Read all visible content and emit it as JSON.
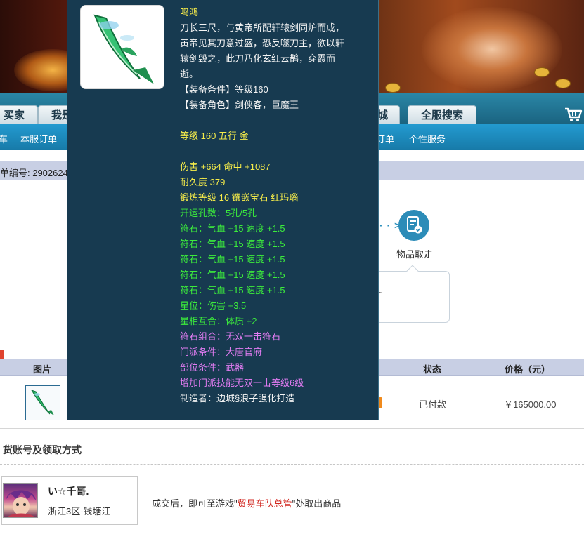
{
  "nav": {
    "tabs": [
      {
        "label": "买家"
      },
      {
        "label": "我是"
      },
      {
        "label": "城"
      },
      {
        "label": "全服搜索"
      }
    ]
  },
  "subnav": {
    "items": [
      {
        "label": "车"
      },
      {
        "label": "本服订单"
      },
      {
        "label": "订单"
      },
      {
        "label": "个性服务"
      }
    ]
  },
  "order": {
    "number_text": "单编号: 2902624"
  },
  "progress": {
    "arrow_text": "· · >",
    "step_label": "物品取走",
    "tooltip_text": "~"
  },
  "table": {
    "headers": {
      "image": "图片",
      "status": "状态",
      "price": "价格（元）"
    },
    "row": {
      "status": "已付款",
      "price": "￥165000.00"
    }
  },
  "section": {
    "title": "货账号及领取方式"
  },
  "seller": {
    "name": "い☆千哥.",
    "server": "浙江3区-钱塘江"
  },
  "pickup": {
    "before": "成交后，即可至游戏\"",
    "highlight": "贸易车队总管",
    "after": "\"处取出商品"
  },
  "item_popup": {
    "name": "鸣鸿",
    "desc_lines": [
      "刀长三尺，与黄帝所配轩辕剑同炉而成，",
      "黄帝见其刀意过盛，恐反噬刀主，欲以轩",
      "辕剑毁之，此刀乃化玄红云鹊，穿霞而",
      "逝。"
    ],
    "requirement": "【装备条件】等级160",
    "role": "【装备角色】剑侠客，巨魔王",
    "level_line": "等级 160 五行 金",
    "attack_line": "伤害 +664 命中 +1087",
    "durability_line": "耐久度 379",
    "forge_line": "锻炼等级 16 镶嵌宝石 红玛瑙",
    "holes_line": "开运孔数：5孔/5孔",
    "rune_lines": [
      "符石：气血 +15 速度 +1.5",
      "符石：气血 +15 速度 +1.5",
      "符石：气血 +15 速度 +1.5",
      "符石：气血 +15 速度 +1.5",
      "符石：气血 +15 速度 +1.5"
    ],
    "star_line": "星位：伤害 +3.5",
    "star_combo_line": "星相互合：体质 +2",
    "rune_combo_line": "符石组合：无双一击符石",
    "school_line": "门派条件：大唐官府",
    "slot_line": "部位条件：武器",
    "skill_line": "增加门派技能无双一击等级6级",
    "maker_line": "制造者：边城§浪子强化打造",
    "colors": {
      "yellow": "#f6ec4a",
      "white": "#f4f4f4",
      "green": "#3cec3c",
      "purple": "#e17cf2"
    }
  },
  "icons": {
    "cart": "shopping-cart-icon",
    "step": "document-check-icon",
    "weapon": "jade-sword-icon"
  }
}
